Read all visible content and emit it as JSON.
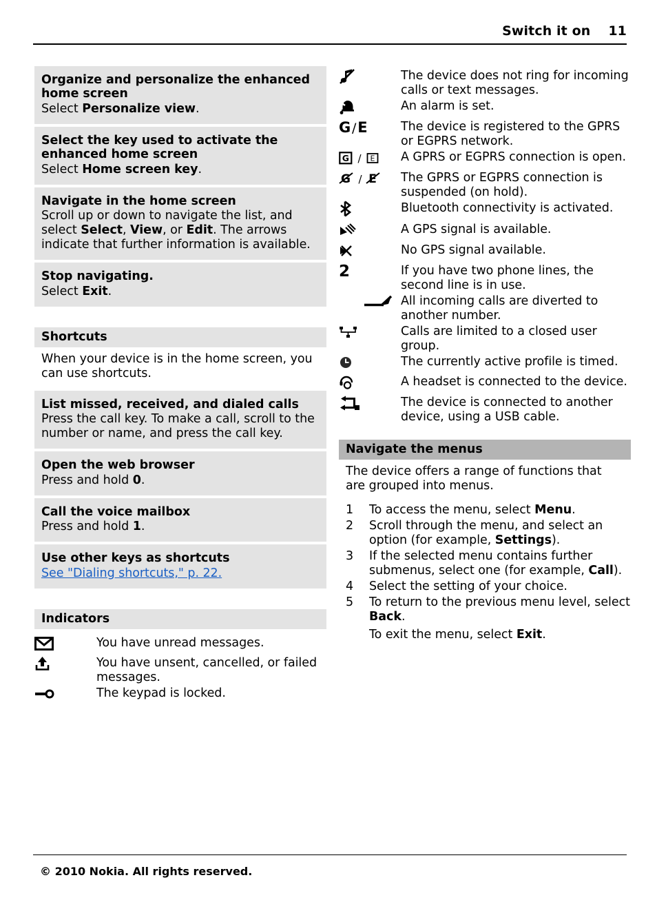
{
  "header": {
    "title": "Switch it on",
    "page_number": "11"
  },
  "left_column": {
    "task_blocks": [
      {
        "heading": "Organize and personalize the enhanced home screen",
        "body_prefix": "Select ",
        "body_bold": "Personalize view",
        "body_suffix": "."
      },
      {
        "heading": "Select the key used to activate the enhanced home screen",
        "body_prefix": "Select ",
        "body_bold": "Home screen key",
        "body_suffix": "."
      },
      {
        "heading": "Navigate in the home screen",
        "body_full": "Scroll up or down to navigate the list, and select Select, View, or Edit. The arrows indicate that further information is available."
      },
      {
        "heading": "Stop navigating.",
        "body_prefix": "Select ",
        "body_bold": "Exit",
        "body_suffix": "."
      }
    ],
    "navigate_body": {
      "t1": "Scroll up or down to navigate the list, and select ",
      "b1": "Select",
      "t2": ", ",
      "b2": "View",
      "t3": ", or ",
      "b3": "Edit",
      "t4": ". The arrows indicate that further information is available."
    },
    "shortcuts_section": {
      "heading": "Shortcuts",
      "intro": "When your device is in the home screen, you can use shortcuts.",
      "blocks": [
        {
          "heading": "List missed, received, and dialed calls",
          "body": "Press the call key. To make a call, scroll to the number or name, and press the call key."
        },
        {
          "heading": "Open the web browser",
          "body_prefix": "Press and hold ",
          "body_bold": "0",
          "body_suffix": "."
        },
        {
          "heading": "Call the voice mailbox",
          "body_prefix": "Press and hold ",
          "body_bold": "1",
          "body_suffix": "."
        },
        {
          "heading": "Use other keys as shortcuts",
          "link_text": "See \"Dialing shortcuts,\" p. 22."
        }
      ]
    },
    "indicators_section": {
      "heading": "Indicators",
      "items": [
        {
          "icon": "envelope-icon",
          "text": "You have unread messages."
        },
        {
          "icon": "outbox-upload-icon",
          "text": "You have unsent, cancelled, or failed messages."
        },
        {
          "icon": "keypad-lock-key-icon",
          "text": "The keypad is locked."
        }
      ]
    }
  },
  "right_column": {
    "indicators": [
      {
        "icon": "silent-note-icon",
        "text": "The device does not ring for incoming calls or text messages."
      },
      {
        "icon": "alarm-bell-icon",
        "text": "An alarm is set."
      },
      {
        "icon": "gprs-egprs-registered-icon",
        "glyph": "G/E",
        "text": "The device is registered to the GPRS or EGPRS network."
      },
      {
        "icon": "gprs-egprs-open-icon",
        "glyph": "G/E boxed",
        "text": "A GPRS or EGPRS connection is open."
      },
      {
        "icon": "gprs-egprs-suspended-icon",
        "glyph": "G/E struck",
        "text": "The GPRS or EGPRS connection is suspended (on hold)."
      },
      {
        "icon": "bluetooth-icon",
        "text": "Bluetooth connectivity is activated."
      },
      {
        "icon": "gps-signal-icon",
        "text": "A GPS signal is available."
      },
      {
        "icon": "gps-no-signal-icon",
        "text": "No GPS signal available."
      },
      {
        "icon": "line-two-icon",
        "glyph": "2",
        "text": "If you have two phone lines, the second line is in use."
      },
      {
        "icon": "call-divert-arrow-icon",
        "text": "All incoming calls are diverted to another number."
      },
      {
        "icon": "closed-user-group-icon",
        "text": "Calls are limited to a closed user group."
      },
      {
        "icon": "timed-profile-clock-icon",
        "text": "The currently active profile is timed."
      },
      {
        "icon": "headset-icon",
        "text": "A headset is connected to the device."
      },
      {
        "icon": "usb-cable-icon",
        "text": "The device is connected to another device, using a USB cable."
      }
    ],
    "menus_section": {
      "heading": "Navigate the menus",
      "intro": "The device offers a range of functions that are grouped into menus.",
      "steps": [
        {
          "num": "1",
          "t1": "To access the menu, select ",
          "b1": "Menu",
          "t2": "."
        },
        {
          "num": "2",
          "t1": "Scroll through the menu, and select an option (for example, ",
          "b1": "Settings",
          "t2": ")."
        },
        {
          "num": "3",
          "t1": "If the selected menu contains further submenus, select one (for example, ",
          "b1": "Call",
          "t2": ")."
        },
        {
          "num": "4",
          "t1": "Select the setting of your choice.",
          "b1": "",
          "t2": ""
        },
        {
          "num": "5",
          "t1": "To return to the previous menu level, select ",
          "b1": "Back",
          "t2": "."
        }
      ],
      "trailing_note": {
        "t1": "To exit the menu, select ",
        "b1": "Exit",
        "t2": "."
      }
    }
  },
  "footer": {
    "copyright": "© 2010 Nokia. All rights reserved."
  },
  "colors": {
    "block_gray": "#e3e3e3",
    "section_dark_gray": "#b4b4b4",
    "link_blue": "#1a5fc4"
  }
}
